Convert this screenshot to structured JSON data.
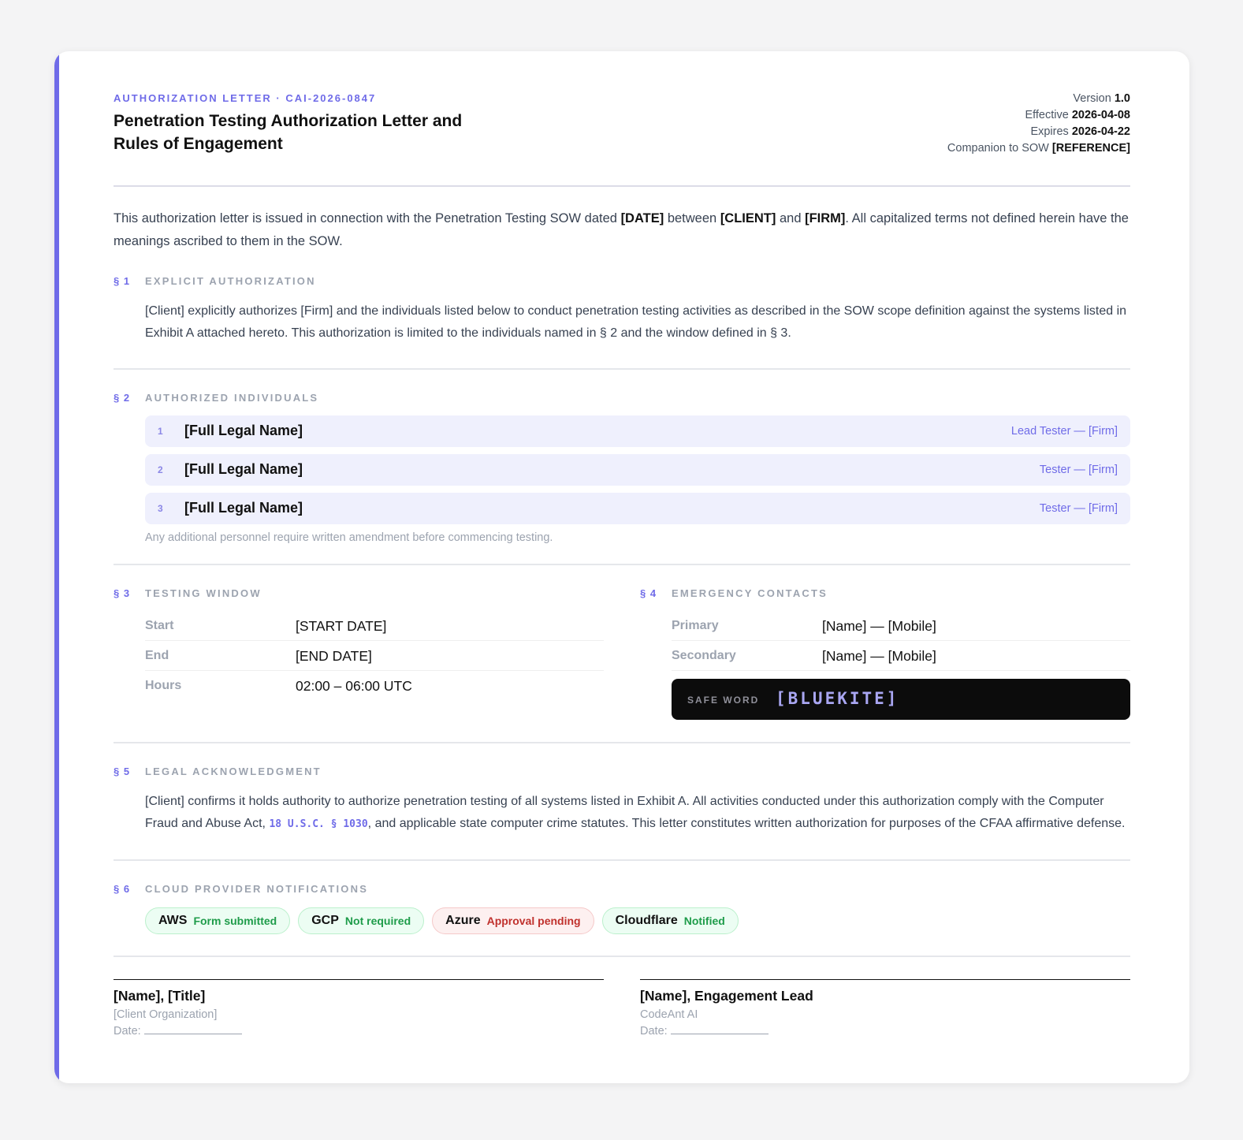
{
  "header": {
    "eyebrow": "AUTHORIZATION LETTER · CAI-2026-0847",
    "title": "Penetration Testing Authorization Letter and Rules of Engagement",
    "meta": [
      {
        "label": "Version",
        "value": "1.0"
      },
      {
        "label": "Effective",
        "value": "2026-04-08"
      },
      {
        "label": "Expires",
        "value": "2026-04-22"
      },
      {
        "label": "Companion to SOW",
        "value": "[REFERENCE]"
      }
    ]
  },
  "intro": {
    "t1": "This authorization letter is issued in connection with the Penetration Testing SOW dated ",
    "date": "[DATE]",
    "t2": " between ",
    "client": "[CLIENT]",
    "t3": " and ",
    "firm": "[FIRM]",
    "t4": ". All capitalized terms not defined herein have the meanings ascribed to them in the SOW."
  },
  "s1": {
    "num": "§ 1",
    "label": "EXPLICIT AUTHORIZATION",
    "text": "[Client] explicitly authorizes [Firm] and the individuals listed below to conduct penetration testing activities as described in the SOW scope definition against the systems listed in Exhibit A attached hereto. This authorization is limited to the individuals named in § 2 and the window defined in § 3."
  },
  "s2": {
    "num": "§ 2",
    "label": "AUTHORIZED INDIVIDUALS",
    "people": [
      {
        "n": "1",
        "name": "[Full Legal Name]",
        "role": "Lead Tester — [Firm]"
      },
      {
        "n": "2",
        "name": "[Full Legal Name]",
        "role": "Tester — [Firm]"
      },
      {
        "n": "3",
        "name": "[Full Legal Name]",
        "role": "Tester — [Firm]"
      }
    ],
    "note": "Any additional personnel require written amendment before commencing testing."
  },
  "s3": {
    "num": "§ 3",
    "label": "TESTING WINDOW",
    "rows": [
      {
        "k": "Start",
        "v": "[START DATE]"
      },
      {
        "k": "End",
        "v": "[END DATE]"
      },
      {
        "k": "Hours",
        "v": "02:00 – 06:00 UTC"
      }
    ]
  },
  "s4": {
    "num": "§ 4",
    "label": "EMERGENCY CONTACTS",
    "rows": [
      {
        "k": "Primary",
        "v": "[Name] — [Mobile]"
      },
      {
        "k": "Secondary",
        "v": "[Name] — [Mobile]"
      }
    ],
    "safe_word_label": "SAFE WORD",
    "safe_word": "[BLUEKITE]"
  },
  "s5": {
    "num": "§ 5",
    "label": "LEGAL ACKNOWLEDGMENT",
    "t1": "[Client] confirms it holds authority to authorize penetration testing of all systems listed in Exhibit A. All activities conducted under this authorization comply with the Computer Fraud and Abuse Act, ",
    "code": "18 U.S.C. § 1030",
    "t2": ", and applicable state computer crime statutes. This letter constitutes written authorization for purposes of the CFAA affirmative defense."
  },
  "s6": {
    "num": "§ 6",
    "label": "CLOUD PROVIDER NOTIFICATIONS",
    "providers": [
      {
        "name": "AWS",
        "status": "Form submitted",
        "tone": "green"
      },
      {
        "name": "GCP",
        "status": "Not required",
        "tone": "green"
      },
      {
        "name": "Azure",
        "status": "Approval pending",
        "tone": "red"
      },
      {
        "name": "Cloudflare",
        "status": "Notified",
        "tone": "green"
      }
    ]
  },
  "signatures": [
    {
      "name": "[Name], [Title]",
      "org": "[Client Organization]",
      "date_label": "Date:"
    },
    {
      "name": "[Name], Engagement Lead",
      "org": "CodeAnt AI",
      "date_label": "Date:"
    }
  ],
  "colors": {
    "accent": "#6f6be8",
    "safe_word_bg": "#0c0c0c",
    "ok": "#1e9c4a",
    "pending": "#c0312d"
  }
}
